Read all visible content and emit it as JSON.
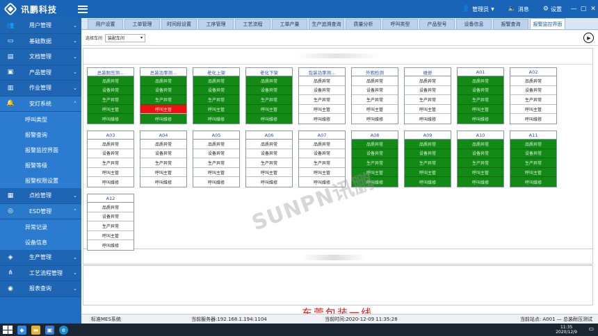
{
  "app": {
    "title": "讯鹏科技"
  },
  "header": {
    "user_label": "管理员",
    "messages_label": "消息",
    "settings_label": "设置",
    "win_controls": [
      "—",
      "▢",
      "✕"
    ]
  },
  "sidebar": {
    "items": [
      {
        "label": "用户管理",
        "icon": "users-icon"
      },
      {
        "label": "基础数据",
        "icon": "monitor-icon"
      },
      {
        "label": "文档管理",
        "icon": "document-icon"
      },
      {
        "label": "产品管理",
        "icon": "box-icon"
      },
      {
        "label": "作业管理",
        "icon": "factory-icon"
      },
      {
        "label": "安灯系统",
        "icon": "bell-icon",
        "open": true
      }
    ],
    "andon_sub": [
      "呼叫类型",
      "报警查询",
      "报警监控界面",
      "报警等级",
      "报警权限设置"
    ],
    "items2": [
      {
        "label": "点检管理",
        "icon": "checklist-icon"
      },
      {
        "label": "ESD管理",
        "icon": "esd-icon",
        "open": true
      }
    ],
    "esd_sub": [
      "异常记录",
      "设备信息"
    ],
    "items3": [
      {
        "label": "生产管理",
        "icon": "layers-icon"
      },
      {
        "label": "工艺流程管理",
        "icon": "flow-icon"
      },
      {
        "label": "报表查询",
        "icon": "report-icon"
      }
    ]
  },
  "tabs": [
    "用户设置",
    "工单管理",
    "时间段设置",
    "工序管理",
    "工艺流程",
    "工单产量",
    "生产追溯查询",
    "质量分析",
    "呼叫类型",
    "产品型号",
    "设备信息",
    "报警查询",
    "报警监控界面"
  ],
  "active_tab": 12,
  "filter": {
    "label": "选择车间",
    "value": "装配车间"
  },
  "cell_labels": [
    "品质异常",
    "设备异常",
    "生产异常",
    "呼叫主管",
    "呼叫维修"
  ],
  "stations": [
    {
      "name": "总装耐压测...",
      "status": [
        "green",
        "green",
        "green",
        "green",
        "green"
      ]
    },
    {
      "name": "总装功率测...",
      "status": [
        "green",
        "green",
        "green",
        "red",
        "green"
      ]
    },
    {
      "name": "老化上架",
      "status": [
        "green",
        "green",
        "green",
        "green",
        "green"
      ]
    },
    {
      "name": "老化下架",
      "status": [
        "green",
        "green",
        "green",
        "green",
        "green"
      ]
    },
    {
      "name": "包装功率测...",
      "status": [
        "white",
        "white",
        "white",
        "white",
        "white"
      ]
    },
    {
      "name": "外观检测",
      "status": [
        "white",
        "white",
        "white",
        "white",
        "white"
      ]
    },
    {
      "name": "维修",
      "status": [
        "white",
        "white",
        "white",
        "white",
        "white"
      ]
    },
    {
      "name": "A01",
      "status": [
        "green",
        "green",
        "green",
        "green",
        "green"
      ]
    },
    {
      "name": "A02",
      "status": [
        "white",
        "white",
        "white",
        "white",
        "white"
      ]
    },
    {
      "name": "A03",
      "status": [
        "white",
        "white",
        "white",
        "white",
        "white"
      ]
    },
    {
      "name": "A04",
      "status": [
        "white",
        "white",
        "white",
        "white",
        "white"
      ]
    },
    {
      "name": "A05",
      "status": [
        "white",
        "white",
        "white",
        "white",
        "white"
      ]
    },
    {
      "name": "A06",
      "status": [
        "white",
        "white",
        "white",
        "white",
        "white"
      ]
    },
    {
      "name": "A07",
      "status": [
        "white",
        "white",
        "white",
        "white",
        "white"
      ]
    },
    {
      "name": "A08",
      "status": [
        "green",
        "green",
        "green",
        "green",
        "green"
      ]
    },
    {
      "name": "A09",
      "status": [
        "green",
        "green",
        "green",
        "green",
        "green"
      ]
    },
    {
      "name": "A10",
      "status": [
        "green",
        "green",
        "green",
        "green",
        "green"
      ]
    },
    {
      "name": "A11",
      "status": [
        "green",
        "green",
        "green",
        "green",
        "green"
      ]
    },
    {
      "name": "A12",
      "status": [
        "white",
        "white",
        "white",
        "white",
        "white"
      ]
    }
  ],
  "watermark": "SUNPN讯鹏",
  "line_title": "东莞包装一线",
  "status": {
    "system": "标准MES系统",
    "server": "当前服务器:192.168.1.194:1104",
    "time": "当前时间:2020-12-09 11:35:28",
    "station": "当前站点: A001 — 总装耐压测试"
  },
  "taskbar": {
    "time": "11:35",
    "date": "2020/12/9"
  },
  "colors": {
    "header": "#1a64b8",
    "sidebar": "#1f6ec2",
    "green": "#138a16",
    "red": "#ee1111"
  }
}
